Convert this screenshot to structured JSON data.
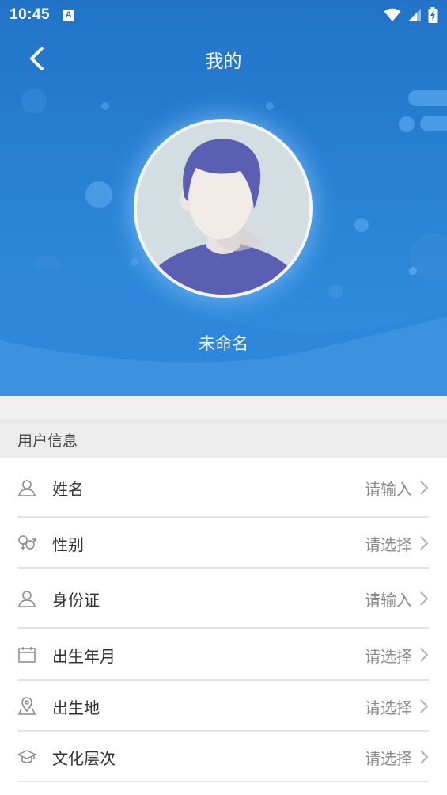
{
  "status_bar": {
    "time": "10:45",
    "notification_letter": "A",
    "icons": [
      "wifi-icon",
      "cellular-signal-icon",
      "battery-charging-icon"
    ]
  },
  "header": {
    "back_icon": "chevron-left-icon",
    "title": "我的"
  },
  "profile": {
    "avatar_icon": "default-avatar-icon",
    "name": "未命名"
  },
  "section": {
    "title": "用户信息"
  },
  "rows": [
    {
      "icon": "person-icon",
      "label": "姓名",
      "value": "请输入"
    },
    {
      "icon": "gender-icon",
      "label": "性别",
      "value": "请选择"
    },
    {
      "icon": "person-icon",
      "label": "身份证",
      "value": "请输入"
    },
    {
      "icon": "calendar-icon",
      "label": "出生年月",
      "value": "请选择"
    },
    {
      "icon": "location-pin-icon",
      "label": "出生地",
      "value": "请选择"
    },
    {
      "icon": "graduation-cap-icon",
      "label": "文化层次",
      "value": "请选择"
    }
  ],
  "colors": {
    "header_blue": "#2273c8",
    "header_light_blue": "#3690e0",
    "text_primary": "#333333",
    "text_placeholder": "#8a8a8a",
    "section_bg": "#ececec"
  }
}
